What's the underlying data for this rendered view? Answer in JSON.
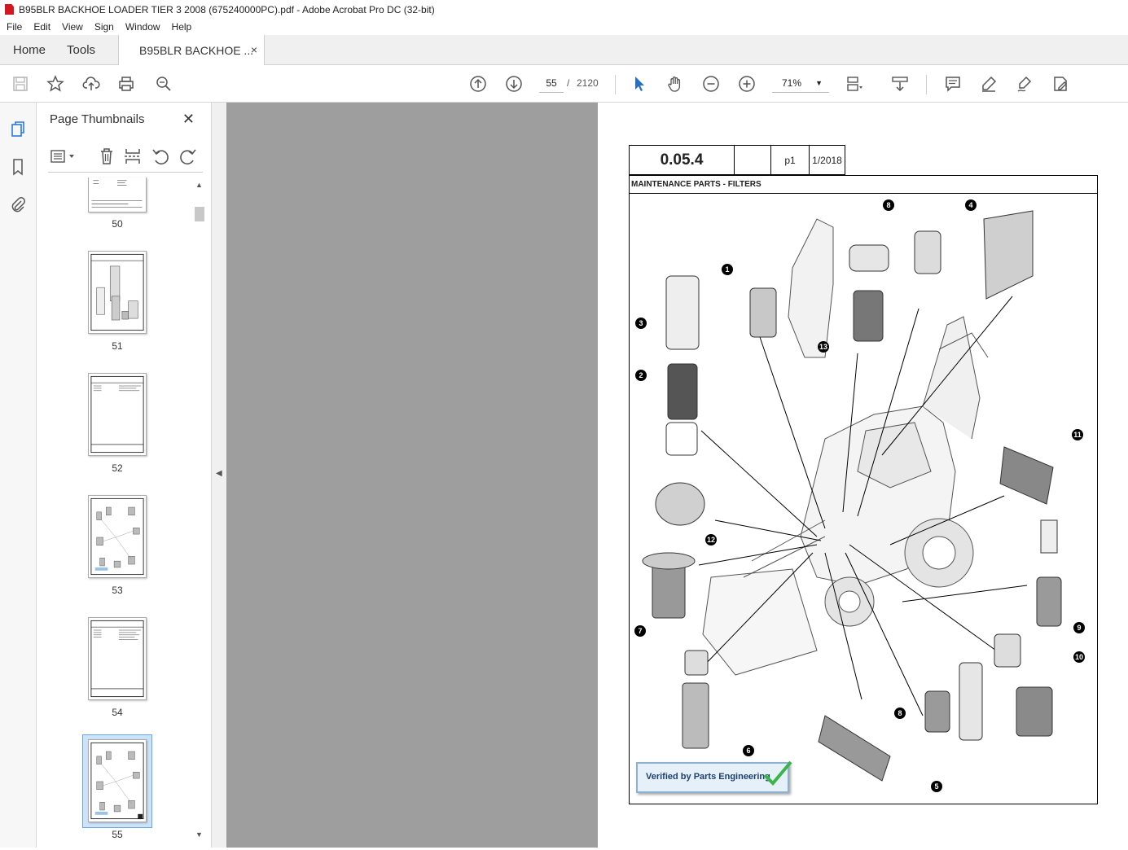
{
  "window": {
    "title": "B95BLR BACKHOE LOADER TIER 3 2008 (675240000PC).pdf - Adobe Acrobat Pro DC (32-bit)"
  },
  "menu": [
    "File",
    "Edit",
    "View",
    "Sign",
    "Window",
    "Help"
  ],
  "tabs": {
    "home": "Home",
    "tools": "Tools",
    "document": "B95BLR BACKHOE ...",
    "close": "×"
  },
  "toolbar": {
    "current_page": "55",
    "page_separator": "/",
    "page_count": "2120",
    "zoom": "71%",
    "icons": [
      "save-icon",
      "bookmark-star-icon",
      "upload-icon",
      "print-icon",
      "search-zoom-icon",
      "page-up-icon",
      "page-down-icon",
      "select-cursor-icon",
      "hand-icon",
      "zoom-out-icon",
      "zoom-in-icon",
      "page-fit-icon",
      "scroll-mode-icon",
      "comment-icon",
      "highlight-icon",
      "sign-icon",
      "edit-pdf-icon"
    ]
  },
  "panel": {
    "title": "Page Thumbnails",
    "close": "✕",
    "thumbnails": [
      {
        "label": "50"
      },
      {
        "label": "51"
      },
      {
        "label": "52"
      },
      {
        "label": "53"
      },
      {
        "label": "54"
      },
      {
        "label": "55",
        "selected": true
      }
    ]
  },
  "document": {
    "section_code": "0.05.4",
    "page_ref": "p1",
    "date": "1/2018",
    "section_title": "MAINTENANCE PARTS - FILTERS",
    "callouts": [
      "1",
      "2",
      "3",
      "4",
      "5",
      "6",
      "7",
      "8",
      "8",
      "9",
      "10",
      "11",
      "12",
      "13"
    ],
    "stamp": "Verified by Parts Engineering"
  },
  "colors": {
    "accent": "#2b7bd8",
    "canvas": "#9e9e9e",
    "acrobat_red": "#d3171f"
  }
}
